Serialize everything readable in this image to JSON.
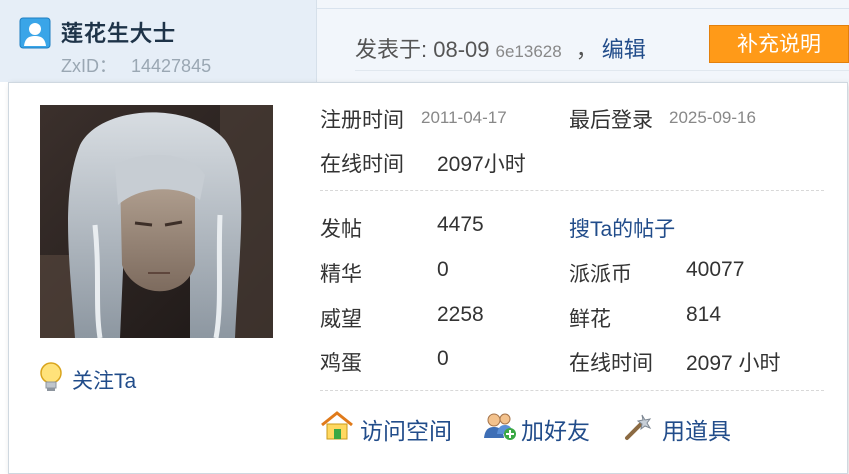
{
  "user": {
    "name": "莲花生大士",
    "zxid_label": "ZxID：",
    "zxid_value": "14427845"
  },
  "post": {
    "posted_label": "发表于: 08-09",
    "hash": "6e13628",
    "separator": "，",
    "edit_label": "编辑",
    "supplement_label": "补充说明"
  },
  "profile": {
    "registered_label": "注册时间",
    "registered_value": "2011-04-17",
    "last_login_label": "最后登录",
    "last_login_value": "2025-09-16",
    "online_label": "在线时间",
    "online_value": "2097小时",
    "follow_label": "关注Ta"
  },
  "stats": {
    "posts_label": "发帖",
    "posts_value": "4475",
    "search_posts_link": "搜Ta的帖子",
    "digest_label": "精华",
    "digest_value": "0",
    "coins_label": "派派币",
    "coins_value": "40077",
    "prestige_label": "威望",
    "prestige_value": "2258",
    "flowers_label": "鲜花",
    "flowers_value": "814",
    "eggs_label": "鸡蛋",
    "eggs_value": "0",
    "online2_label": "在线时间",
    "online2_value": "2097 小时"
  },
  "actions": {
    "visit_space": "访问空间",
    "add_friend": "加好友",
    "use_item": "用道具"
  },
  "icons": {
    "user": "user-icon",
    "follow": "lightbulb-icon",
    "visit": "home-icon",
    "friend": "add-friend-icon",
    "item": "magic-wand-icon"
  },
  "colors": {
    "link": "#214c8a",
    "accent_button": "#ff9a18",
    "header_bg": "#e6eef7"
  }
}
